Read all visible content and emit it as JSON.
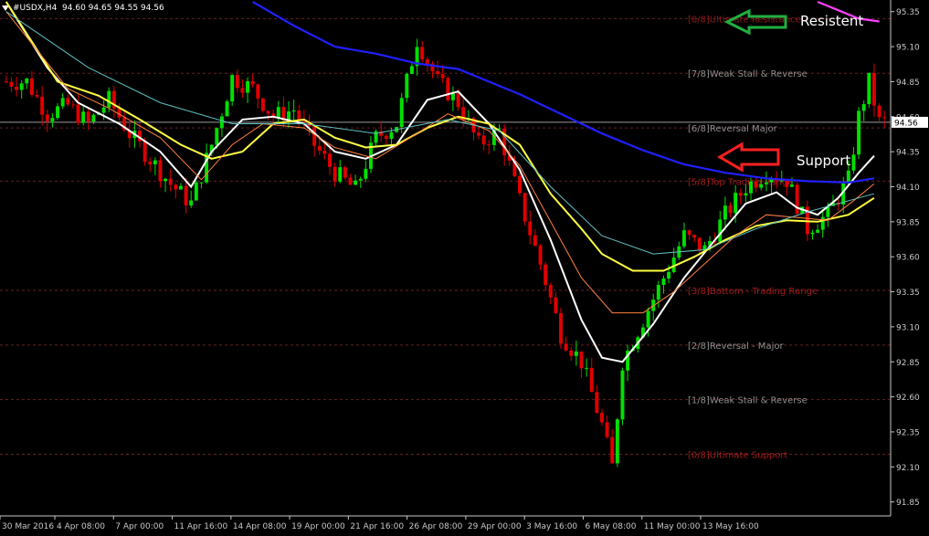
{
  "header": {
    "symbol": "#USDX,H4",
    "ohlc": "94.60 94.65 94.55 94.56"
  },
  "colors": {
    "background": "#000000",
    "bull": "#00e000",
    "bear": "#e00000",
    "ma_blue": "#2020ff",
    "ma_white": "#ffffff",
    "ma_yellow": "#ffff40",
    "ma_magenta": "#ff40ff",
    "ma_orange": "#ff8040",
    "ma_teal": "#60c0c0",
    "level_line": "#6a2020",
    "axis_text": "#c8c8c8",
    "current_price_bg": "#ffffff"
  },
  "annotations": {
    "resistance_label": "Resistent",
    "support_label": "Support"
  },
  "chart_data": {
    "type": "candlestick",
    "title": "",
    "xlabel": "",
    "ylabel": "",
    "ylim": [
      91.75,
      95.42
    ],
    "grid": false,
    "current_price": "94.56",
    "current_price_value": 94.56,
    "y_ticks": [
      "95.35",
      "95.10",
      "94.85",
      "94.60",
      "94.35",
      "94.10",
      "93.85",
      "93.60",
      "93.35",
      "93.10",
      "92.85",
      "92.60",
      "92.35",
      "92.10",
      "91.85"
    ],
    "x_ticks": [
      "30 Mar 2016",
      "4 Apr 08:00",
      "7 Apr 00:00",
      "11 Apr 16:00",
      "14 Apr 08:00",
      "19 Apr 00:00",
      "21 Apr 16:00",
      "26 Apr 08:00",
      "29 Apr 00:00",
      "3 May 16:00",
      "6 May 08:00",
      "11 May 00:00",
      "13 May 16:00"
    ],
    "murrey_levels": [
      {
        "label": "[8/8]Ultimate Resistance",
        "price": 95.3,
        "color": "#8a1a1a"
      },
      {
        "label": "[7/8]Weak Stall & Reverse",
        "price": 94.91,
        "color": "#909090"
      },
      {
        "label": "[6/8]Reversal Major",
        "price": 94.52,
        "color": "#909090"
      },
      {
        "label": "[5/8]Top Trading Range",
        "price": 94.14,
        "color": "#a01c1c"
      },
      {
        "label": "[3/8]Bottom - Trading Range",
        "price": 93.36,
        "color": "#a01c1c"
      },
      {
        "label": "[2/8]Reversal - Major",
        "price": 92.97,
        "color": "#909090"
      },
      {
        "label": "[1/8]Weak Stall & Reverse",
        "price": 92.58,
        "color": "#909090"
      },
      {
        "label": "[0/8]Ultimate Support",
        "price": 92.19,
        "color": "#a01c1c"
      }
    ],
    "price_path": [
      [
        0,
        94.85
      ],
      [
        4,
        94.85
      ],
      [
        8,
        94.62
      ],
      [
        12,
        94.68
      ],
      [
        16,
        94.55
      ],
      [
        20,
        94.72
      ],
      [
        24,
        94.48
      ],
      [
        28,
        94.3
      ],
      [
        32,
        94.12
      ],
      [
        36,
        93.98
      ],
      [
        40,
        94.4
      ],
      [
        44,
        94.88
      ],
      [
        48,
        94.8
      ],
      [
        52,
        94.6
      ],
      [
        56,
        94.65
      ],
      [
        60,
        94.4
      ],
      [
        64,
        94.2
      ],
      [
        68,
        94.08
      ],
      [
        72,
        94.45
      ],
      [
        76,
        94.55
      ],
      [
        80,
        95.15
      ],
      [
        84,
        94.85
      ],
      [
        88,
        94.7
      ],
      [
        92,
        94.4
      ],
      [
        96,
        94.5
      ],
      [
        100,
        94.0
      ],
      [
        104,
        93.55
      ],
      [
        108,
        93.05
      ],
      [
        112,
        92.85
      ],
      [
        116,
        92.4
      ],
      [
        118,
        92.1
      ],
      [
        120,
        92.85
      ],
      [
        124,
        93.15
      ],
      [
        128,
        93.45
      ],
      [
        132,
        93.75
      ],
      [
        136,
        93.65
      ],
      [
        140,
        93.9
      ],
      [
        144,
        94.1
      ],
      [
        148,
        94.2
      ],
      [
        152,
        94.15
      ],
      [
        156,
        93.8
      ],
      [
        160,
        93.9
      ],
      [
        164,
        94.15
      ],
      [
        166,
        94.6
      ],
      [
        168,
        94.85
      ],
      [
        170,
        94.56
      ]
    ],
    "n_bars": 172,
    "series": [
      {
        "color": "#ffffff",
        "values": [
          [
            0,
            95.42
          ],
          [
            8,
            94.95
          ],
          [
            14,
            94.7
          ],
          [
            22,
            94.55
          ],
          [
            30,
            94.35
          ],
          [
            36,
            94.1
          ],
          [
            40,
            94.35
          ],
          [
            46,
            94.58
          ],
          [
            52,
            94.6
          ],
          [
            58,
            94.55
          ],
          [
            64,
            94.35
          ],
          [
            70,
            94.3
          ],
          [
            76,
            94.4
          ],
          [
            82,
            94.72
          ],
          [
            88,
            94.78
          ],
          [
            94,
            94.55
          ],
          [
            100,
            94.22
          ],
          [
            106,
            93.72
          ],
          [
            112,
            93.15
          ],
          [
            116,
            92.88
          ],
          [
            120,
            92.85
          ],
          [
            126,
            93.12
          ],
          [
            132,
            93.45
          ],
          [
            138,
            93.72
          ],
          [
            144,
            93.98
          ],
          [
            150,
            94.06
          ],
          [
            154,
            93.95
          ],
          [
            158,
            93.9
          ],
          [
            162,
            94.02
          ],
          [
            166,
            94.2
          ],
          [
            169,
            94.32
          ]
        ]
      },
      {
        "color": "#ffff40",
        "values": [
          [
            0,
            95.42
          ],
          [
            10,
            94.85
          ],
          [
            18,
            94.75
          ],
          [
            26,
            94.58
          ],
          [
            34,
            94.4
          ],
          [
            40,
            94.3
          ],
          [
            46,
            94.35
          ],
          [
            52,
            94.55
          ],
          [
            58,
            94.58
          ],
          [
            64,
            94.45
          ],
          [
            70,
            94.38
          ],
          [
            76,
            94.4
          ],
          [
            82,
            94.52
          ],
          [
            88,
            94.6
          ],
          [
            94,
            94.55
          ],
          [
            100,
            94.4
          ],
          [
            106,
            94.05
          ],
          [
            112,
            93.8
          ],
          [
            116,
            93.62
          ],
          [
            122,
            93.5
          ],
          [
            128,
            93.5
          ],
          [
            134,
            93.6
          ],
          [
            140,
            93.72
          ],
          [
            146,
            93.82
          ],
          [
            152,
            93.86
          ],
          [
            158,
            93.85
          ],
          [
            164,
            93.9
          ],
          [
            169,
            94.02
          ]
        ]
      },
      {
        "color": "#ff8040",
        "values": [
          [
            0,
            95.35
          ],
          [
            12,
            94.8
          ],
          [
            20,
            94.66
          ],
          [
            30,
            94.45
          ],
          [
            38,
            94.15
          ],
          [
            44,
            94.4
          ],
          [
            50,
            94.55
          ],
          [
            58,
            94.52
          ],
          [
            64,
            94.38
          ],
          [
            72,
            94.3
          ],
          [
            80,
            94.48
          ],
          [
            86,
            94.62
          ],
          [
            94,
            94.5
          ],
          [
            100,
            94.25
          ],
          [
            106,
            93.85
          ],
          [
            112,
            93.45
          ],
          [
            118,
            93.2
          ],
          [
            124,
            93.2
          ],
          [
            130,
            93.35
          ],
          [
            136,
            93.55
          ],
          [
            142,
            93.75
          ],
          [
            148,
            93.9
          ],
          [
            154,
            93.88
          ],
          [
            160,
            93.86
          ],
          [
            165,
            94.0
          ],
          [
            169,
            94.12
          ]
        ]
      },
      {
        "color": "#2020ff",
        "values": [
          [
            48,
            95.42
          ],
          [
            56,
            95.25
          ],
          [
            64,
            95.1
          ],
          [
            72,
            95.05
          ],
          [
            80,
            94.98
          ],
          [
            88,
            94.94
          ],
          [
            94,
            94.85
          ],
          [
            100,
            94.76
          ],
          [
            108,
            94.62
          ],
          [
            116,
            94.48
          ],
          [
            124,
            94.36
          ],
          [
            132,
            94.26
          ],
          [
            140,
            94.2
          ],
          [
            148,
            94.16
          ],
          [
            156,
            94.14
          ],
          [
            164,
            94.13
          ],
          [
            169,
            94.16
          ]
        ]
      },
      {
        "color": "#ff40ff",
        "values": [
          [
            158,
            95.42
          ],
          [
            162,
            95.36
          ],
          [
            166,
            95.3
          ],
          [
            170,
            95.28
          ]
        ]
      },
      {
        "color": "#60c0c0",
        "values": [
          [
            0,
            95.35
          ],
          [
            16,
            94.95
          ],
          [
            30,
            94.7
          ],
          [
            44,
            94.55
          ],
          [
            58,
            94.55
          ],
          [
            72,
            94.48
          ],
          [
            86,
            94.58
          ],
          [
            96,
            94.5
          ],
          [
            106,
            94.1
          ],
          [
            116,
            93.75
          ],
          [
            126,
            93.62
          ],
          [
            136,
            93.65
          ],
          [
            146,
            93.8
          ],
          [
            156,
            93.92
          ],
          [
            169,
            94.05
          ]
        ]
      }
    ]
  }
}
